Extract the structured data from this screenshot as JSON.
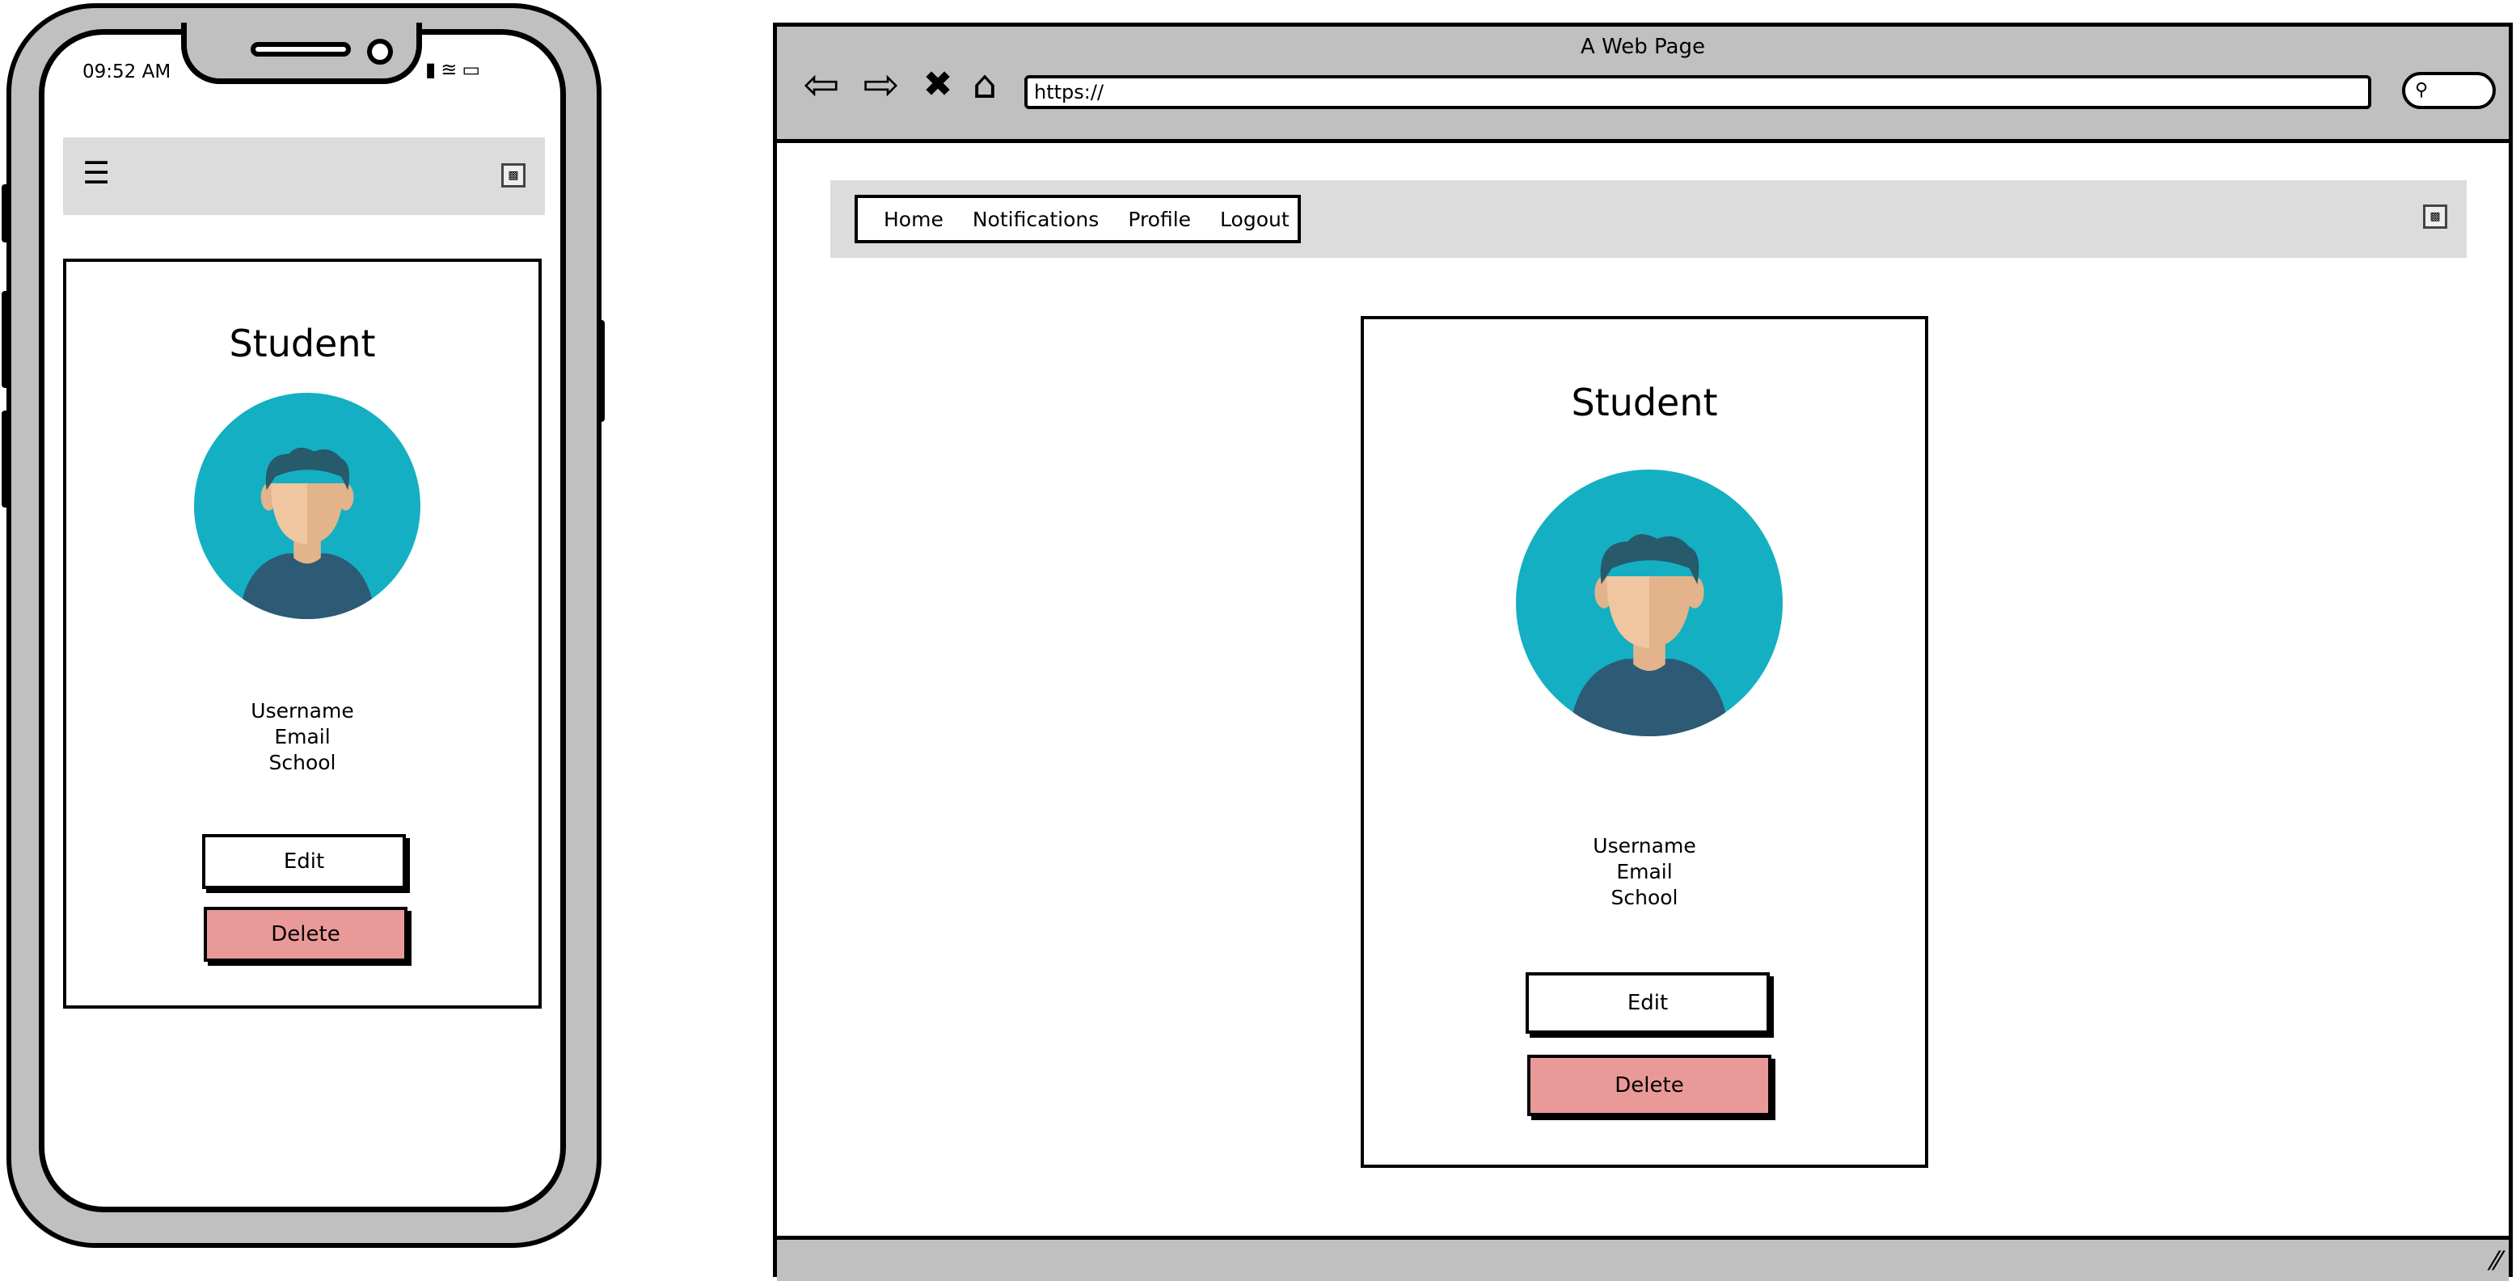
{
  "mobile": {
    "status_time": "09:52 AM",
    "menu_icon": "hamburger-menu-icon",
    "card": {
      "title": "Student",
      "fields": [
        "Username",
        "Email",
        "School"
      ],
      "edit_label": "Edit",
      "delete_label": "Delete"
    }
  },
  "browser": {
    "window_title": "A Web Page",
    "url": "https://",
    "nav_items": [
      "Home",
      "Notifications",
      "Profile",
      "Logout"
    ],
    "card": {
      "title": "Student",
      "fields": [
        "Username",
        "Email",
        "School"
      ],
      "edit_label": "Edit",
      "delete_label": "Delete"
    }
  },
  "colors": {
    "delete_button": "#ea9999",
    "navbar": "#dcdcdc",
    "frame": "#c0c0c0",
    "avatar_bg": "#14afc2",
    "avatar_shirt": "#2d5a75",
    "avatar_skin": "#efc6a0"
  }
}
